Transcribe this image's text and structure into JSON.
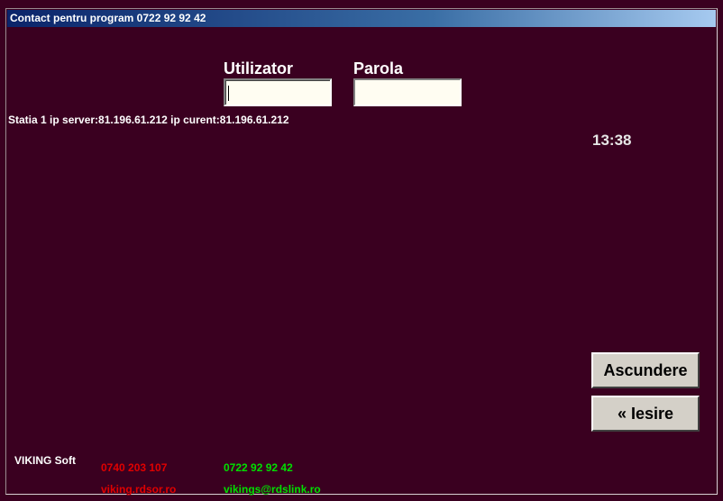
{
  "window": {
    "title": "Contact pentru program  0722 92 92 42",
    "titlebar_colors": [
      "#0a246a",
      "#a6caf0"
    ],
    "background": "#3a0020"
  },
  "login": {
    "user_label": "Utilizator",
    "user_value": "",
    "password_label": "Parola",
    "password_value": ""
  },
  "status_text": "Statia 1 ip server:81.196.61.212 ip curent:81.196.61.212",
  "clock": "13:38",
  "buttons": {
    "hide_label": "Ascundere",
    "exit_label": "« Iesire"
  },
  "footer": {
    "company": "VIKING Soft",
    "phone_red": "0740 203 107",
    "site_red": "viking.rdsor.ro",
    "phone_green": "0722 92 92 42",
    "email_green": "vikings@rdslink.ro"
  }
}
